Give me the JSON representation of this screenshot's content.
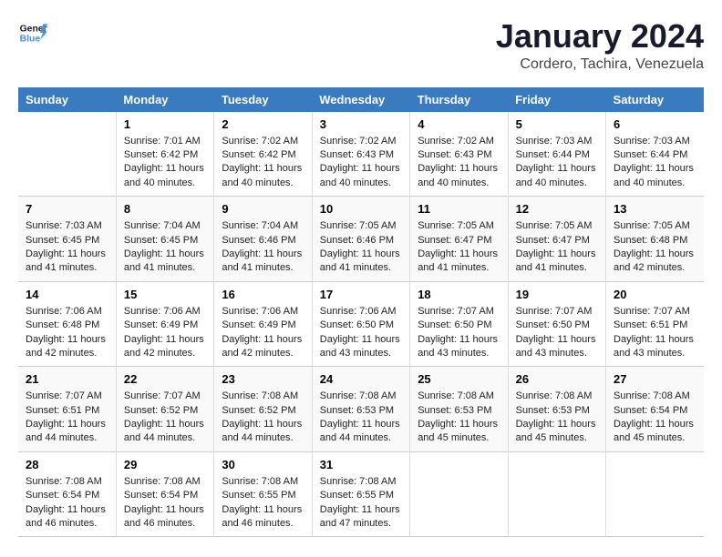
{
  "header": {
    "logo_line1": "General",
    "logo_line2": "Blue",
    "month": "January 2024",
    "location": "Cordero, Tachira, Venezuela"
  },
  "days_of_week": [
    "Sunday",
    "Monday",
    "Tuesday",
    "Wednesday",
    "Thursday",
    "Friday",
    "Saturday"
  ],
  "weeks": [
    [
      {
        "day": "",
        "info": ""
      },
      {
        "day": "1",
        "info": "Sunrise: 7:01 AM\nSunset: 6:42 PM\nDaylight: 11 hours\nand 40 minutes."
      },
      {
        "day": "2",
        "info": "Sunrise: 7:02 AM\nSunset: 6:42 PM\nDaylight: 11 hours\nand 40 minutes."
      },
      {
        "day": "3",
        "info": "Sunrise: 7:02 AM\nSunset: 6:43 PM\nDaylight: 11 hours\nand 40 minutes."
      },
      {
        "day": "4",
        "info": "Sunrise: 7:02 AM\nSunset: 6:43 PM\nDaylight: 11 hours\nand 40 minutes."
      },
      {
        "day": "5",
        "info": "Sunrise: 7:03 AM\nSunset: 6:44 PM\nDaylight: 11 hours\nand 40 minutes."
      },
      {
        "day": "6",
        "info": "Sunrise: 7:03 AM\nSunset: 6:44 PM\nDaylight: 11 hours\nand 40 minutes."
      }
    ],
    [
      {
        "day": "7",
        "info": "Sunrise: 7:03 AM\nSunset: 6:45 PM\nDaylight: 11 hours\nand 41 minutes."
      },
      {
        "day": "8",
        "info": "Sunrise: 7:04 AM\nSunset: 6:45 PM\nDaylight: 11 hours\nand 41 minutes."
      },
      {
        "day": "9",
        "info": "Sunrise: 7:04 AM\nSunset: 6:46 PM\nDaylight: 11 hours\nand 41 minutes."
      },
      {
        "day": "10",
        "info": "Sunrise: 7:05 AM\nSunset: 6:46 PM\nDaylight: 11 hours\nand 41 minutes."
      },
      {
        "day": "11",
        "info": "Sunrise: 7:05 AM\nSunset: 6:47 PM\nDaylight: 11 hours\nand 41 minutes."
      },
      {
        "day": "12",
        "info": "Sunrise: 7:05 AM\nSunset: 6:47 PM\nDaylight: 11 hours\nand 41 minutes."
      },
      {
        "day": "13",
        "info": "Sunrise: 7:05 AM\nSunset: 6:48 PM\nDaylight: 11 hours\nand 42 minutes."
      }
    ],
    [
      {
        "day": "14",
        "info": "Sunrise: 7:06 AM\nSunset: 6:48 PM\nDaylight: 11 hours\nand 42 minutes."
      },
      {
        "day": "15",
        "info": "Sunrise: 7:06 AM\nSunset: 6:49 PM\nDaylight: 11 hours\nand 42 minutes."
      },
      {
        "day": "16",
        "info": "Sunrise: 7:06 AM\nSunset: 6:49 PM\nDaylight: 11 hours\nand 42 minutes."
      },
      {
        "day": "17",
        "info": "Sunrise: 7:06 AM\nSunset: 6:50 PM\nDaylight: 11 hours\nand 43 minutes."
      },
      {
        "day": "18",
        "info": "Sunrise: 7:07 AM\nSunset: 6:50 PM\nDaylight: 11 hours\nand 43 minutes."
      },
      {
        "day": "19",
        "info": "Sunrise: 7:07 AM\nSunset: 6:50 PM\nDaylight: 11 hours\nand 43 minutes."
      },
      {
        "day": "20",
        "info": "Sunrise: 7:07 AM\nSunset: 6:51 PM\nDaylight: 11 hours\nand 43 minutes."
      }
    ],
    [
      {
        "day": "21",
        "info": "Sunrise: 7:07 AM\nSunset: 6:51 PM\nDaylight: 11 hours\nand 44 minutes."
      },
      {
        "day": "22",
        "info": "Sunrise: 7:07 AM\nSunset: 6:52 PM\nDaylight: 11 hours\nand 44 minutes."
      },
      {
        "day": "23",
        "info": "Sunrise: 7:08 AM\nSunset: 6:52 PM\nDaylight: 11 hours\nand 44 minutes."
      },
      {
        "day": "24",
        "info": "Sunrise: 7:08 AM\nSunset: 6:53 PM\nDaylight: 11 hours\nand 44 minutes."
      },
      {
        "day": "25",
        "info": "Sunrise: 7:08 AM\nSunset: 6:53 PM\nDaylight: 11 hours\nand 45 minutes."
      },
      {
        "day": "26",
        "info": "Sunrise: 7:08 AM\nSunset: 6:53 PM\nDaylight: 11 hours\nand 45 minutes."
      },
      {
        "day": "27",
        "info": "Sunrise: 7:08 AM\nSunset: 6:54 PM\nDaylight: 11 hours\nand 45 minutes."
      }
    ],
    [
      {
        "day": "28",
        "info": "Sunrise: 7:08 AM\nSunset: 6:54 PM\nDaylight: 11 hours\nand 46 minutes."
      },
      {
        "day": "29",
        "info": "Sunrise: 7:08 AM\nSunset: 6:54 PM\nDaylight: 11 hours\nand 46 minutes."
      },
      {
        "day": "30",
        "info": "Sunrise: 7:08 AM\nSunset: 6:55 PM\nDaylight: 11 hours\nand 46 minutes."
      },
      {
        "day": "31",
        "info": "Sunrise: 7:08 AM\nSunset: 6:55 PM\nDaylight: 11 hours\nand 47 minutes."
      },
      {
        "day": "",
        "info": ""
      },
      {
        "day": "",
        "info": ""
      },
      {
        "day": "",
        "info": ""
      }
    ]
  ]
}
